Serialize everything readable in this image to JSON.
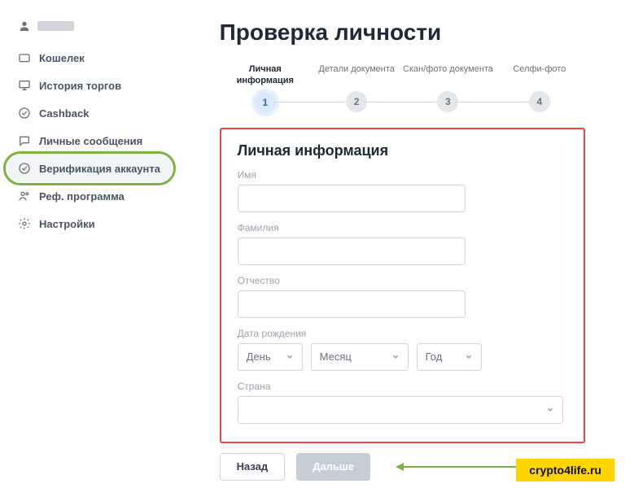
{
  "sidebar": {
    "items": [
      {
        "label": "Кошелек"
      },
      {
        "label": "История торгов"
      },
      {
        "label": "Cashback"
      },
      {
        "label": "Личные сообщения"
      },
      {
        "label": "Верификация аккаунта"
      },
      {
        "label": "Реф. программа"
      },
      {
        "label": "Настройки"
      }
    ]
  },
  "page": {
    "title": "Проверка личности"
  },
  "steps": [
    {
      "num": "1",
      "label": "Личная информация"
    },
    {
      "num": "2",
      "label": "Детали документа"
    },
    {
      "num": "3",
      "label": "Скан/фото документа"
    },
    {
      "num": "4",
      "label": "Селфи-фото"
    }
  ],
  "form": {
    "title": "Личная информация",
    "first_name_label": "Имя",
    "last_name_label": "Фамилия",
    "middle_name_label": "Отчество",
    "dob_label": "Дата рождения",
    "day_placeholder": "День",
    "month_placeholder": "Месяц",
    "year_placeholder": "Год",
    "country_label": "Страна"
  },
  "buttons": {
    "back": "Назад",
    "next": "Дальше"
  },
  "watermark": "crypto4life.ru"
}
